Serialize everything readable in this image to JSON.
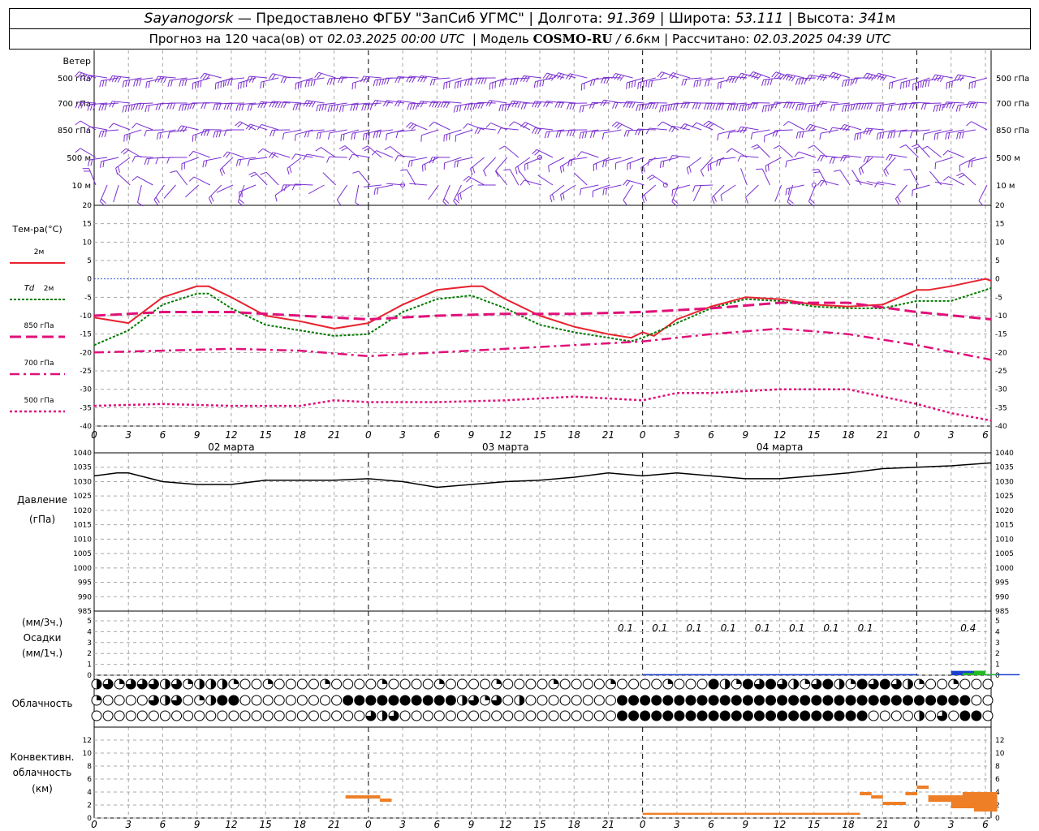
{
  "header": {
    "station": "Sayanogorsk",
    "dash": "—",
    "provider": "Предоставлено ФГБУ \"ЗапСиб УГМС\"",
    "sep": "|",
    "lon_label": "Долгота:",
    "lon_value": "91.369",
    "lat_label": "Широта:",
    "lat_value": "53.111",
    "alt_label": "Высота:",
    "alt_value": "341",
    "alt_unit": "м",
    "forecast_prefix": "Прогноз на 120 часа(ов) от",
    "forecast_start": "02.03.2025 00:00 UTC",
    "model_label": "Модель",
    "model_name": "COSMO-RU",
    "model_slash": "/",
    "model_res": "6.6",
    "model_res_unit": "км",
    "computed_label": "Рассчитано:",
    "computed_time": "02.03.2025 04:39 UTC"
  },
  "wind_panel": {
    "title": "Ветер",
    "levels": [
      "500 гПа",
      "700 гПа",
      "850 гПа",
      "500 м",
      "10  м"
    ]
  },
  "temp_panel": {
    "title": "Тем-ра(°C)",
    "legend": [
      {
        "label": "2м",
        "color": "#e8222e"
      },
      {
        "label_italic": "Td",
        "label": "2м",
        "color": "#007a00"
      },
      {
        "label": "850 гПа",
        "color": "#e0107a"
      },
      {
        "label": "700 гПа",
        "color": "#e0107a"
      },
      {
        "label": "500 гПа",
        "color": "#e0107a"
      }
    ],
    "y_ticks": [
      20,
      15,
      10,
      5,
      0,
      -5,
      -10,
      -15,
      -20,
      -25,
      -30,
      -35,
      -40
    ]
  },
  "time_axis": {
    "hour_labels": [
      "0",
      "3",
      "6",
      "9",
      "12",
      "15",
      "18",
      "21",
      "0",
      "3",
      "6",
      "9",
      "12",
      "15",
      "18",
      "21",
      "0",
      "3",
      "6",
      "9",
      "12",
      "15",
      "18",
      "21",
      "0",
      "3",
      "6"
    ],
    "date_labels": [
      "02 марта",
      "03 марта",
      "04 марта"
    ]
  },
  "pressure_panel": {
    "title": "Давление",
    "unit": "(гПа)",
    "y_ticks": [
      1040,
      1035,
      1030,
      1025,
      1020,
      1015,
      1010,
      1005,
      1000,
      995,
      990,
      985
    ]
  },
  "precip_panel": {
    "label_3h": "(мм/3ч.)",
    "title": "Осадки",
    "label_1h": "(мм/1ч.)",
    "y_ticks": [
      5,
      4,
      3,
      2,
      1,
      0
    ],
    "annotations": [
      "0.1",
      "0.1",
      "0.1",
      "0.1",
      "0.1",
      "0.1",
      "0.1",
      "0.1",
      "0.4"
    ]
  },
  "cloud_panel": {
    "title": "Облачность"
  },
  "conv_panel": {
    "title_line1": "Конвективн.",
    "title_line2": "облачность",
    "unit": "(км)",
    "y_ticks": [
      12,
      10,
      8,
      6,
      4,
      2,
      0
    ]
  },
  "colors": {
    "wind": "#7a2fd0",
    "temp_2m": "#e8222e",
    "dewpoint": "#007a00",
    "upper_air": "#e0107a",
    "zero_line": "#3b5bdb",
    "precip_3h": "#1a3fd0",
    "precip_1h": "#22bb22",
    "convective": "#ee7f27",
    "grid": "#a8a8a8"
  },
  "chart_data": [
    {
      "type": "line",
      "title": "Тем-ра(°C)",
      "x_unit": "forecast hours from 02.03.2025 00:00 UTC",
      "ylim": [
        -40,
        20
      ],
      "series": [
        {
          "name": "2м",
          "x": [
            0,
            3,
            6,
            9,
            10,
            12,
            15,
            18,
            21,
            24,
            27,
            30,
            33,
            34,
            36,
            39,
            42,
            45,
            47,
            48,
            49,
            51,
            54,
            57,
            60,
            63,
            66,
            69,
            72,
            73,
            75,
            78,
            78.5
          ],
          "values": [
            -10.5,
            -12,
            -5,
            -2,
            -2,
            -5,
            -10,
            -11.5,
            -13.5,
            -12,
            -7,
            -3,
            -2,
            -2,
            -5.5,
            -10,
            -13,
            -15,
            -16,
            -14.5,
            -15.5,
            -11,
            -7.5,
            -5,
            -5.5,
            -7,
            -7.5,
            -7,
            -3,
            -3,
            -2,
            0,
            -0.5
          ]
        },
        {
          "name": "Td 2м",
          "x": [
            0,
            3,
            6,
            9,
            10,
            12,
            15,
            18,
            21,
            24,
            27,
            30,
            33,
            36,
            39,
            42,
            45,
            47,
            48,
            51,
            54,
            57,
            60,
            63,
            66,
            69,
            72,
            75,
            78.5
          ],
          "values": [
            -18,
            -14,
            -7,
            -4,
            -4,
            -8,
            -12.5,
            -14,
            -15.5,
            -15,
            -9,
            -5.5,
            -4.5,
            -8,
            -12.5,
            -14.5,
            -16,
            -17,
            -16,
            -12,
            -8,
            -5.5,
            -6,
            -7.5,
            -8,
            -8,
            -6,
            -6,
            -2.5
          ]
        },
        {
          "name": "850 гПа",
          "x": [
            0,
            6,
            12,
            18,
            24,
            30,
            36,
            42,
            48,
            54,
            60,
            66,
            72,
            78.5
          ],
          "values": [
            -10,
            -9,
            -9,
            -10,
            -11,
            -10,
            -9.5,
            -9.5,
            -9,
            -8,
            -6.5,
            -6.5,
            -9,
            -11
          ]
        },
        {
          "name": "700 гПа",
          "x": [
            0,
            6,
            12,
            18,
            24,
            30,
            36,
            42,
            48,
            54,
            60,
            66,
            72,
            78.5
          ],
          "values": [
            -20,
            -19.5,
            -19,
            -19.5,
            -21,
            -20,
            -19,
            -18,
            -17,
            -15,
            -13.5,
            -15,
            -18,
            -22
          ]
        },
        {
          "name": "500 гПа",
          "x": [
            0,
            6,
            12,
            18,
            21,
            24,
            30,
            36,
            42,
            48,
            51,
            54,
            60,
            66,
            72,
            75,
            78.5
          ],
          "values": [
            -34.5,
            -34,
            -34.5,
            -34.5,
            -33,
            -33.5,
            -33.5,
            -33,
            -32,
            -33,
            -31,
            -31,
            -30,
            -30,
            -34,
            -36.5,
            -38.5
          ]
        }
      ]
    },
    {
      "type": "line",
      "title": "Давление",
      "ylim": [
        985,
        1040
      ],
      "series": [
        {
          "name": "Давление",
          "x": [
            0,
            2,
            3,
            6,
            9,
            12,
            15,
            18,
            21,
            24,
            27,
            30,
            33,
            36,
            39,
            42,
            45,
            48,
            51,
            54,
            57,
            60,
            63,
            66,
            69,
            72,
            75,
            78.5
          ],
          "values": [
            1032,
            1033,
            1033,
            1030,
            1029,
            1029,
            1030.5,
            1030.5,
            1030.5,
            1031,
            1030,
            1028,
            1029,
            1030,
            1030.5,
            1031.5,
            1033,
            1032,
            1033,
            1032,
            1031,
            1031,
            1032,
            1033,
            1034.5,
            1035,
            1035.5,
            1036.5
          ]
        }
      ]
    },
    {
      "type": "bar",
      "title": "Осадки",
      "ylim": [
        0,
        5
      ],
      "series": [
        {
          "name": "мм/3ч.",
          "x": [
            48,
            51,
            54,
            57,
            60,
            63,
            66,
            69,
            72,
            75,
            78
          ],
          "values": [
            0.1,
            0.1,
            0.1,
            0.1,
            0.1,
            0.1,
            0.1,
            0.1,
            0,
            0.4,
            0.1
          ]
        },
        {
          "name": "мм/1ч.",
          "x": [
            76,
            77,
            78
          ],
          "values": [
            0.2,
            0.4,
            0.1
          ]
        }
      ]
    },
    {
      "type": "bar",
      "title": "Конвективн. облачность",
      "ylim": [
        0,
        13
      ],
      "series": [
        {
          "name": "base_top_km",
          "x": [
            22,
            23,
            24,
            25,
            48,
            49,
            50,
            51,
            52,
            53,
            54,
            55,
            56,
            57,
            58,
            59,
            60,
            61,
            62,
            63,
            64,
            65,
            66,
            67,
            68,
            69,
            70,
            71,
            72,
            73,
            74,
            75,
            76,
            77,
            78
          ],
          "values": [
            [
              3,
              3.5
            ],
            [
              3,
              3.5
            ],
            [
              3,
              3.5
            ],
            [
              2.5,
              3
            ],
            [
              0.5,
              0.8
            ],
            [
              0.5,
              0.8
            ],
            [
              0.5,
              0.8
            ],
            [
              0.5,
              0.8
            ],
            [
              0.5,
              0.8
            ],
            [
              0.5,
              0.8
            ],
            [
              0.5,
              0.8
            ],
            [
              0.5,
              0.8
            ],
            [
              0.5,
              0.8
            ],
            [
              0.5,
              0.8
            ],
            [
              0.5,
              0.8
            ],
            [
              0.5,
              0.8
            ],
            [
              0.5,
              0.8
            ],
            [
              0.5,
              0.8
            ],
            [
              0.5,
              0.8
            ],
            [
              0.5,
              0.8
            ],
            [
              0.5,
              0.8
            ],
            [
              0.5,
              0.8
            ],
            [
              0.5,
              0.8
            ],
            [
              3.5,
              4
            ],
            [
              3,
              3.5
            ],
            [
              2,
              2.5
            ],
            [
              2,
              2.5
            ],
            [
              3.5,
              4
            ],
            [
              4.5,
              5
            ],
            [
              2.5,
              3.5
            ],
            [
              2.5,
              3.5
            ],
            [
              1.5,
              3.5
            ],
            [
              1.5,
              4
            ],
            [
              1,
              4
            ],
            [
              1,
              4
            ]
          ]
        }
      ]
    }
  ]
}
